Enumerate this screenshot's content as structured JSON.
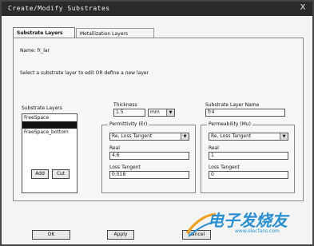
{
  "window": {
    "title": "Create/Modify Substrates",
    "close_glyph": "X"
  },
  "tabs": [
    {
      "label": "Substrate Layers"
    },
    {
      "label": "Metallization Layers"
    }
  ],
  "name_line": "Name: fr_lar",
  "instruction": "Select a substrate layer to edit OR define a new layer",
  "substrate_layers": {
    "label": "Substrate Layers",
    "items": [
      "FreeSpace",
      "",
      "FreeSpace_bottom"
    ],
    "selected_index": 1,
    "add_label": "Add",
    "cut_label": "Cut"
  },
  "thickness": {
    "label": "Thickness",
    "value": "1.5",
    "unit": "mm"
  },
  "permittivity": {
    "group_label": "Permittivity (Er)",
    "type": "Re, Loss Tangent",
    "real_label": "Real",
    "real_value": "4.6",
    "tangent_label": "Loss Tangent",
    "tangent_value": "0.018"
  },
  "layer_name": {
    "label": "Substrate Layer Name",
    "value": "fr4"
  },
  "permeability": {
    "group_label": "Permeability (Mu)",
    "type": "Re, Loss Tangent",
    "real_label": "Real",
    "real_value": "1",
    "tangent_label": "Loss Tangent",
    "tangent_value": "0"
  },
  "footer": {
    "ok_label": "OK",
    "apply_label": "Apply",
    "cancel_label": "Cancel"
  },
  "watermark": {
    "text": "电子发烧友",
    "url": "www.elecfans.com",
    "accent": "#2a8fd0"
  }
}
